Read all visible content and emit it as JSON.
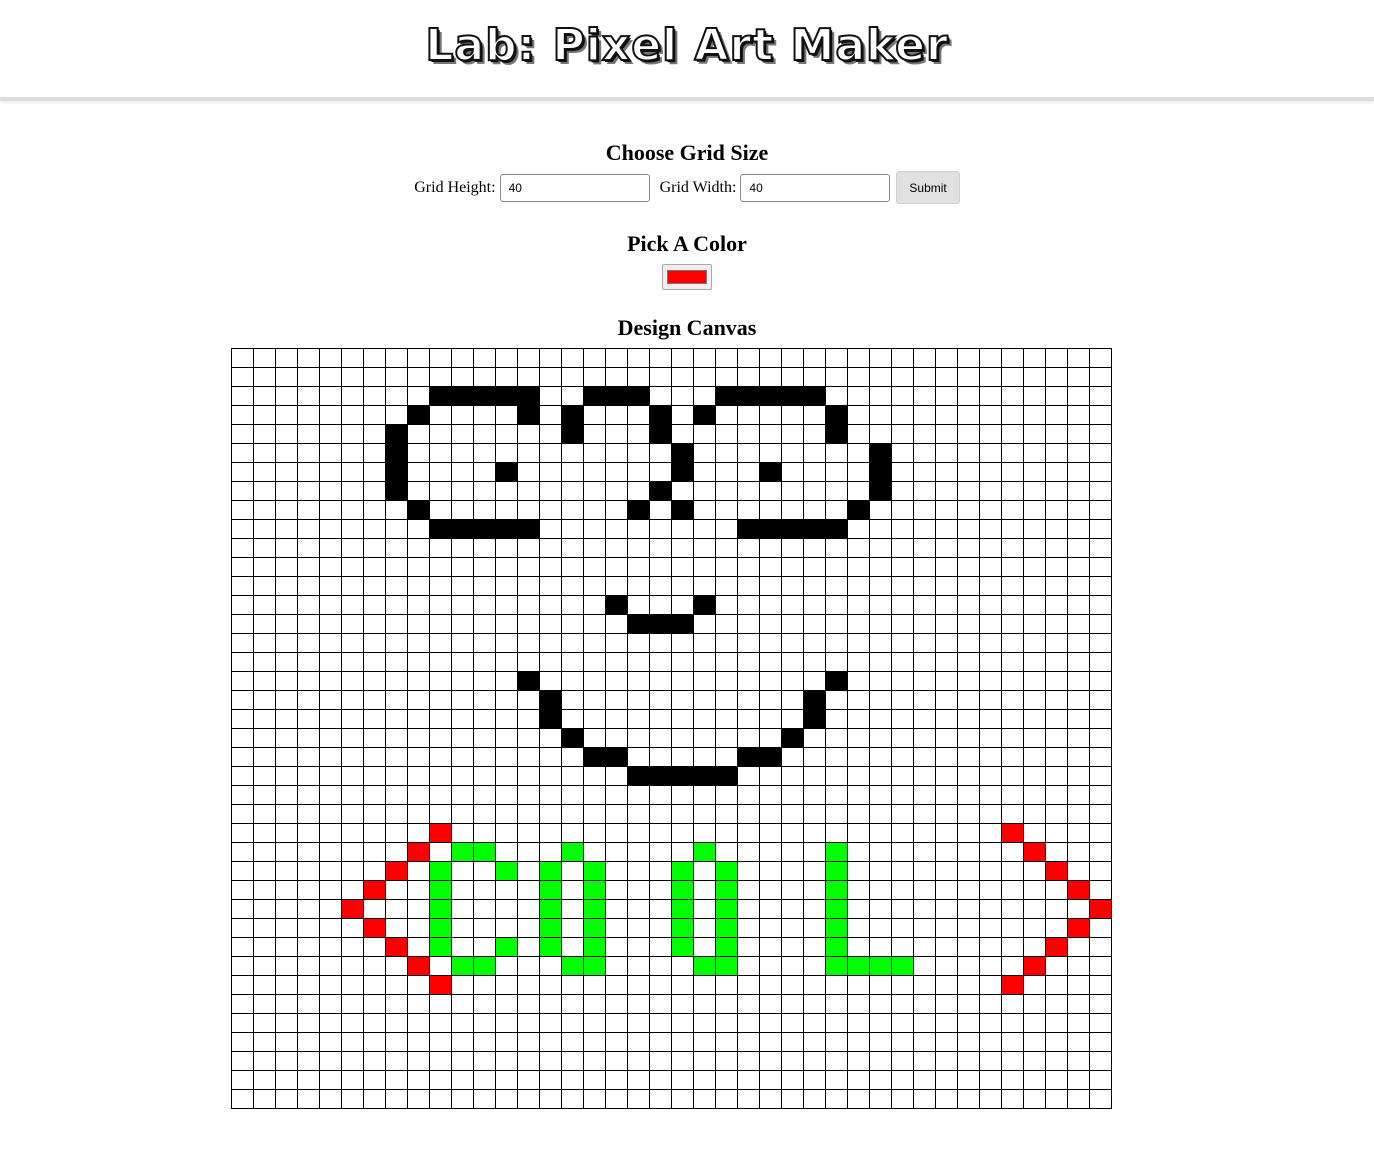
{
  "header": {
    "title": "Lab: Pixel Art Maker"
  },
  "grid_size": {
    "heading": "Choose Grid Size",
    "height_label": "Grid Height:",
    "height_value": "40",
    "width_label": "Grid Width:",
    "width_value": "40",
    "submit_label": "Submit"
  },
  "color_picker": {
    "heading": "Pick A Color",
    "value": "#ff0000"
  },
  "canvas": {
    "heading": "Design Canvas",
    "rows": 40,
    "cols": 40,
    "colors": {
      "k": "#000000",
      "r": "#ff0000",
      "g": "#00ff00"
    },
    "pixels": [
      "........................................",
      "........................................",
      ".........kkkkk..kkk...kkkkk.............",
      "........k....k.k...k.k.....k............",
      ".......k.......k...k.......k............",
      ".......k............k........k..........",
      ".......k....k.......k...k....k..........",
      ".......k...........k.........k..........",
      "........k.........k.k.......k...........",
      ".........kkkkk.........kkkkk............",
      "........................................",
      "........................................",
      "........................................",
      ".................k...k..................",
      "..................kkk...................",
      "........................................",
      "........................................",
      ".............k.............k............",
      "..............k...........k.............",
      "..............k...........k.............",
      "...............k.........k..............",
      "................kk.....kk...............",
      "..................kkkkk.................",
      "........................................",
      "........................................",
      ".........r.........................r....",
      "........r.gg...g.....g.....g........r...",
      ".......r.g..g.g.g...g.g....g.........r..",
      "......r..g....g.g...g.g....g..........r.",
      ".....r...g....g.g...g.g....g...........r",
      "......r..g....g.g...g.g....g..........r.",
      ".......r.g..g.g.g...g.g....g.........r..",
      "........r.gg...gg....gg....gggg.....r...",
      ".........r.........................r....",
      "........................................",
      "........................................",
      "........................................",
      "........................................",
      "........................................",
      "........................................"
    ]
  }
}
